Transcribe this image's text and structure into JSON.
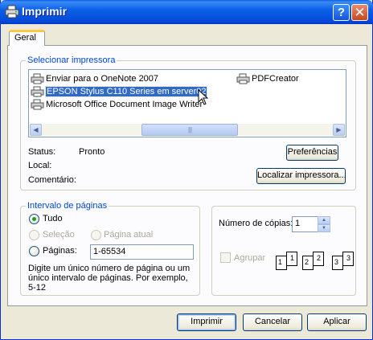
{
  "window": {
    "title": "Imprimir",
    "help_glyph": "?",
    "close_glyph": "✕"
  },
  "tab": {
    "label": "Geral"
  },
  "printer_group": {
    "legend": "Selecionar impressora",
    "printers": [
      {
        "name": "Enviar para o OneNote 2007",
        "icon": "printer-icon"
      },
      {
        "name": "PDFCreator",
        "icon": "printer-icon"
      },
      {
        "name": "EPSON Stylus C110 Series em server02",
        "icon": "network-printer-icon",
        "selected": true
      },
      {
        "name": "Microsoft Office Document Image Writer",
        "icon": "printer-icon"
      }
    ],
    "scroll_thumb_grip": "||||",
    "status_label": "Status:",
    "status_value": "Pronto",
    "location_label": "Local:",
    "comment_label": "Comentário:",
    "preferences_button": "Preferências",
    "find_printer_button": "Localizar impressora..."
  },
  "page_range": {
    "legend": "Intervalo de páginas",
    "all": "Tudo",
    "selection": "Seleção",
    "current_page": "Página atual",
    "pages": "Páginas:",
    "pages_value": "1-65534",
    "selected_option": "all",
    "help_text": "Digite um único número de página ou um único intervalo de páginas. Por exemplo, 5-12"
  },
  "copies": {
    "label": "Número de cópias:",
    "value": "1",
    "collate_label": "Agrupar",
    "collate_checked": false,
    "collate_pages": [
      "1",
      "1",
      "2",
      "2",
      "3",
      "3"
    ]
  },
  "footer": {
    "print_button": "Imprimir",
    "cancel_button": "Cancelar",
    "apply_button": "Aplicar"
  },
  "colors": {
    "titlebar": "#0548d8",
    "selection": "#316ac5",
    "group_legend": "#0046d5",
    "dialog_bg": "#ece9d8"
  }
}
